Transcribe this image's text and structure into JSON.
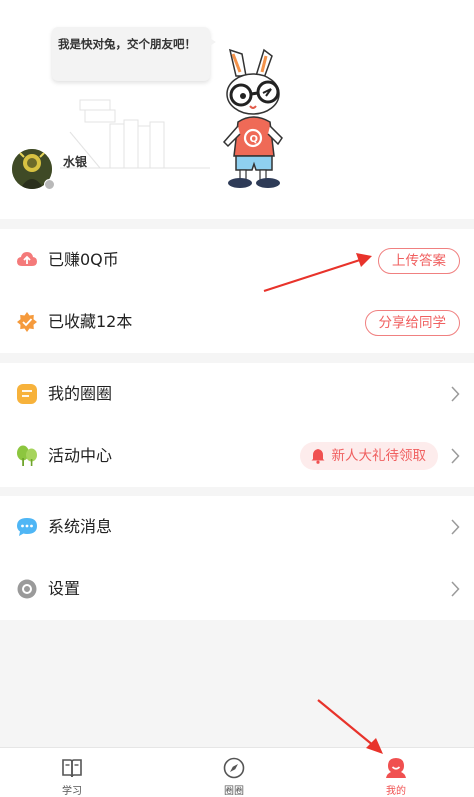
{
  "profile": {
    "speech_bubble": "我是快对兔，交个朋友吧！",
    "username": "水银",
    "mascot_logo": "Q"
  },
  "menu": {
    "coins": {
      "label": "已赚0Q币",
      "button": "上传答案",
      "icon": "cloud-upload-icon"
    },
    "favorites": {
      "label": "已收藏12本",
      "button": "分享给同学",
      "icon": "star-badge-icon"
    },
    "circles": {
      "label": "我的圈圈",
      "icon": "note-icon"
    },
    "activities": {
      "label": "活动中心",
      "promo": "新人大礼待领取",
      "icon": "tree-icon"
    },
    "messages": {
      "label": "系统消息",
      "icon": "chat-bubble-icon"
    },
    "settings": {
      "label": "设置",
      "icon": "gear-icon"
    }
  },
  "tabbar": {
    "tabs": [
      {
        "label": "学习",
        "icon": "book-icon",
        "active": false
      },
      {
        "label": "圈圈",
        "icon": "compass-icon",
        "active": false
      },
      {
        "label": "我的",
        "icon": "person-icon",
        "active": true
      }
    ]
  },
  "colors": {
    "accent": "#f05050",
    "coins_icon": "#f47a7a",
    "star_icon": "#f59a3c",
    "circles_icon": "#f7b23b",
    "activities_icon": "#8cc63f",
    "messages_icon": "#4fb6f5",
    "settings_icon": "#9a9a9a",
    "background": "#f5f5f5"
  }
}
